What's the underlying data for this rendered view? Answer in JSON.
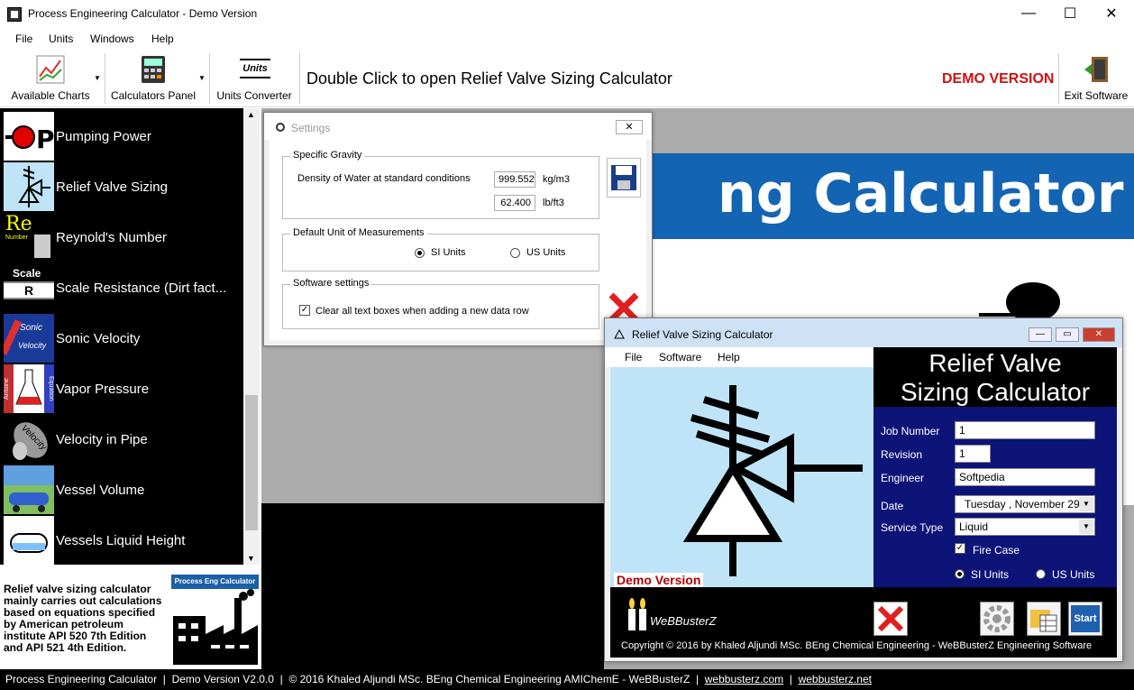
{
  "window": {
    "title": "Process Engineering Calculator - Demo Version",
    "minimize": "—",
    "maximize": "☐",
    "close": "✕"
  },
  "menu": [
    "File",
    "Units",
    "Windows",
    "Help"
  ],
  "toolbar": {
    "available_charts": "Available Charts",
    "calculators_panel": "Calculators Panel",
    "units_converter": "Units Converter",
    "units_icon_text": "Units",
    "hint": "Double Click to open Relief Valve Sizing Calculator",
    "demo_badge": "DEMO VERSION",
    "exit": "Exit Software"
  },
  "calculators": [
    {
      "label": "Pumping Power",
      "icon": "pump-icon"
    },
    {
      "label": "Relief Valve Sizing",
      "icon": "relief-valve-icon"
    },
    {
      "label": "Reynold's Number",
      "icon": "reynolds-icon",
      "thumb_big": "Re",
      "thumb_small": "Number"
    },
    {
      "label": "Scale Resistance (Dirt fact...",
      "icon": "scale-icon",
      "thumb_big": "Scale",
      "thumb_small": "R"
    },
    {
      "label": "Sonic Velocity",
      "icon": "sonic-icon",
      "thumb_big": "Sonic",
      "thumb_small": "Velocity"
    },
    {
      "label": "Vapor Pressure",
      "icon": "flask-icon",
      "thumb_big": "Antoine",
      "thumb_small": "Equation"
    },
    {
      "label": "Velocity in Pipe",
      "icon": "velocity-icon",
      "thumb_big": "Velocity",
      "thumb_small": ""
    },
    {
      "label": "Vessel Volume",
      "icon": "vessel-icon"
    },
    {
      "label": "Vessels Liquid Height",
      "icon": "liquid-height-icon"
    }
  ],
  "description": "Relief valve sizing calculator mainly carries out calculations based on equations specified by American petroleum institute API 520 7th Edition and API 521 4th Edition.",
  "desc_logo_label": "Process Eng Calculator",
  "background_banner": "ng Calculator",
  "settings": {
    "title": "Settings",
    "close": "✕",
    "specific_gravity": {
      "title": "Specific Gravity",
      "label": "Density of Water at standard conditions",
      "value_si": "999.552",
      "unit_si": "kg/m3",
      "value_us": "62.400",
      "unit_us": "lb/ft3"
    },
    "default_units": {
      "title": "Default Unit of Measurements",
      "si": "SI Units",
      "us": "US Units",
      "selected": "SI Units"
    },
    "software": {
      "title": "Software settings",
      "clear_boxes": "Clear all text boxes when adding a new data row",
      "clear_boxes_checked": true
    }
  },
  "relief_valve": {
    "title": "Relief Valve Sizing Calculator",
    "menu": [
      "File",
      "Software",
      "Help"
    ],
    "header_line1": "Relief Valve",
    "header_line2": "Sizing Calculator",
    "fields": {
      "job_number_label": "Job Number",
      "job_number": "1",
      "revision_label": "Revision",
      "revision": "1",
      "engineer_label": "Engineer",
      "engineer": "Softpedia",
      "date_label": "Date",
      "date": "Tuesday  , November 29,",
      "service_type_label": "Service Type",
      "service_type": "Liquid",
      "fire_case": "Fire Case",
      "fire_case_checked": true,
      "si_units": "SI Units",
      "us_units": "US Units",
      "selected_units": "SI Units"
    },
    "demo_label": "Demo Version",
    "brand": "WeBBusterZ",
    "copyright": "Copyright © 2016 by Khaled Aljundi MSc. BEng Chemical Engineering - WeBBusterZ Engineering Software",
    "start": "Start"
  },
  "statusbar": {
    "app": "Process Engineering Calculator",
    "version": "Demo Version V2.0.0",
    "copyright": "© 2016 Khaled Aljundi MSc. BEng Chemical Engineering AMIChemE - WeBBusterZ",
    "link1": "webbusterz.com",
    "link2": "webbusterz.net",
    "sep": "|"
  }
}
